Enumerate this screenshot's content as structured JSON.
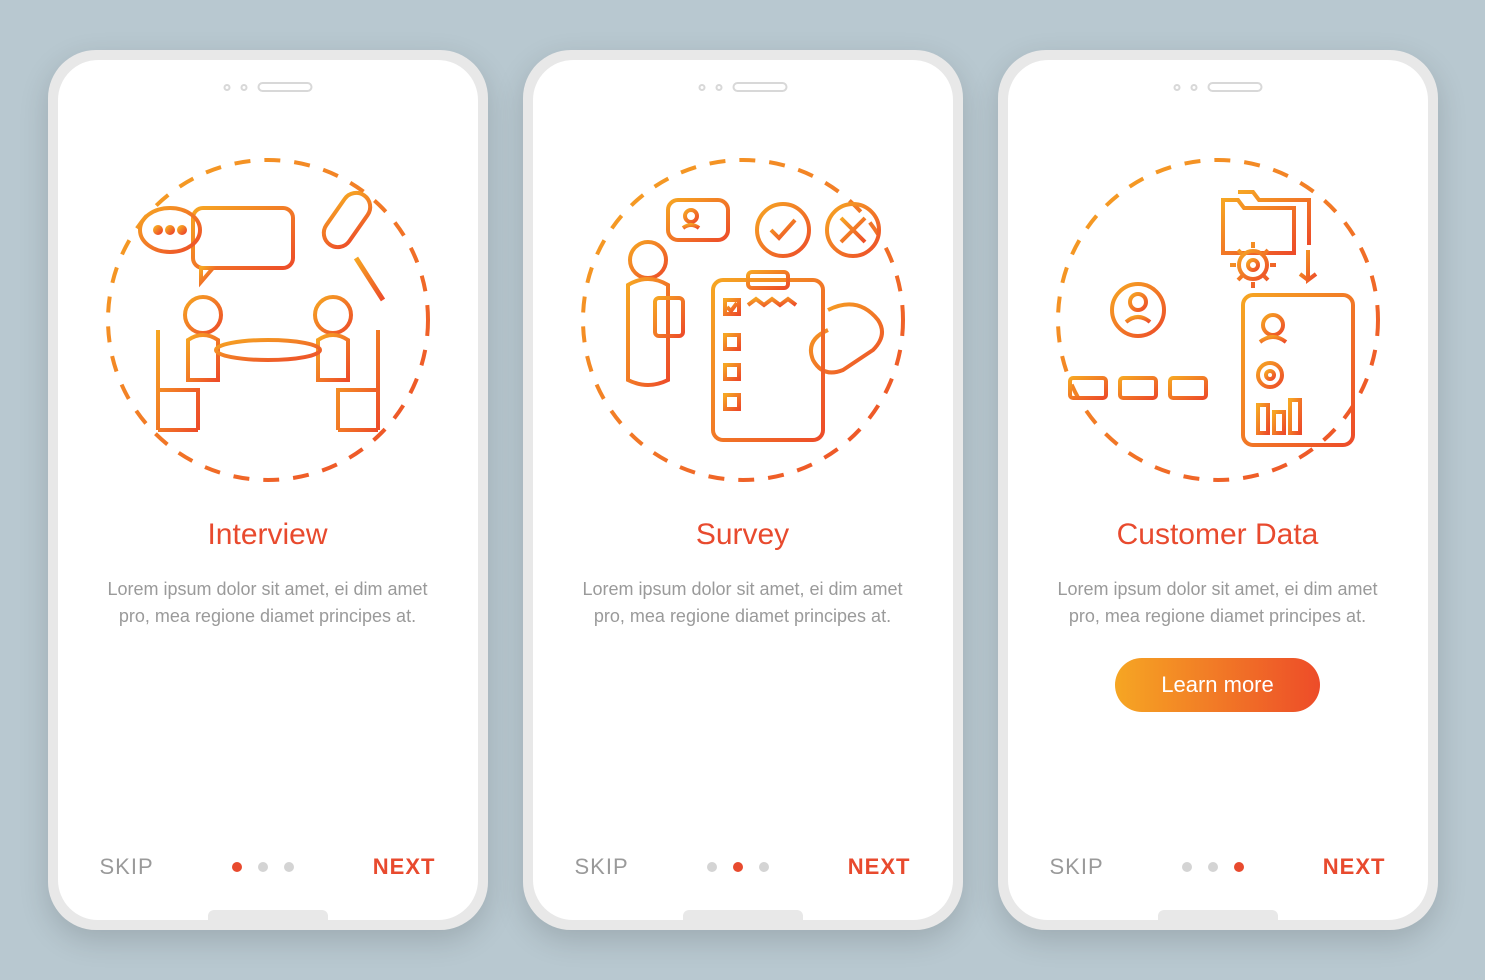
{
  "colors": {
    "accent": "#e84a2e",
    "gradient_start": "#f6a623",
    "gradient_end": "#ed4c29",
    "muted": "#9a9a9a"
  },
  "screens": [
    {
      "icon": "interview-illustration",
      "title": "Interview",
      "description": "Lorem ipsum dolor sit amet, ei dim amet pro, mea regione diamet principes at.",
      "cta": null,
      "skip": "SKIP",
      "next": "NEXT",
      "active_dot": 0,
      "total_dots": 3
    },
    {
      "icon": "survey-illustration",
      "title": "Survey",
      "description": "Lorem ipsum dolor sit amet, ei dim amet pro, mea regione diamet principes at.",
      "cta": null,
      "skip": "SKIP",
      "next": "NEXT",
      "active_dot": 1,
      "total_dots": 3
    },
    {
      "icon": "customer-data-illustration",
      "title": "Customer Data",
      "description": "Lorem ipsum dolor sit amet, ei dim amet pro, mea regione diamet principes at.",
      "cta": "Learn more",
      "skip": "SKIP",
      "next": "NEXT",
      "active_dot": 2,
      "total_dots": 3
    }
  ]
}
